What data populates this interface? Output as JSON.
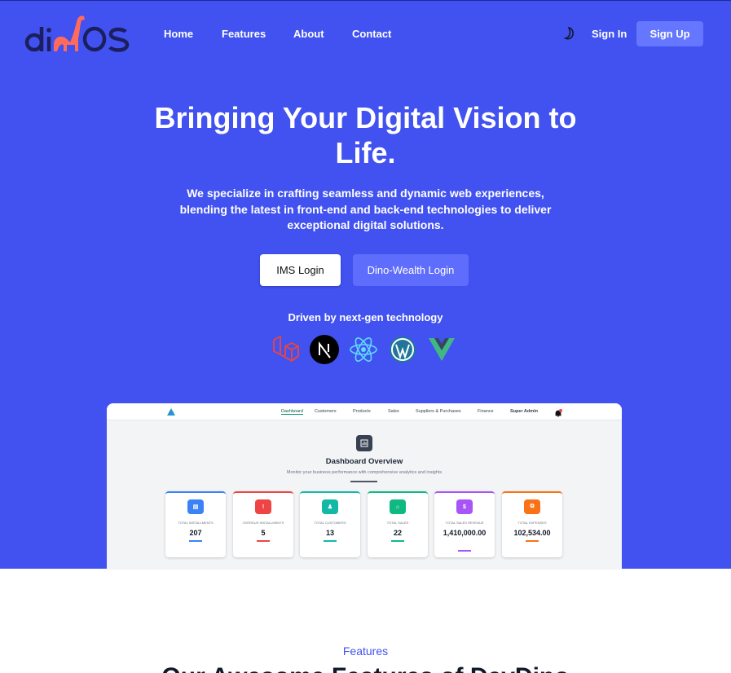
{
  "header": {
    "nav": [
      "Home",
      "Features",
      "About",
      "Contact"
    ],
    "sign_in": "Sign In",
    "sign_up": "Sign Up",
    "theme_icon": "moon-icon"
  },
  "hero": {
    "title": "Bringing Your Digital Vision to Life.",
    "subtitle": "We specialize in crafting seamless and dynamic web experiences, blending the latest in front-end and back-end technologies to deliver exceptional digital solutions.",
    "primary_button": "IMS Login",
    "secondary_button": "Dino-Wealth Login",
    "tech_label": "Driven by next-gen technology",
    "tech_icons": [
      "laravel-icon",
      "nextjs-icon",
      "react-icon",
      "wordpress-icon",
      "vue-icon"
    ]
  },
  "dashboard_preview": {
    "nav": [
      "Dashboard",
      "Customers",
      "Products",
      "Sales",
      "Suppliers & Purchases",
      "Finance",
      "Super Admin"
    ],
    "title": "Dashboard Overview",
    "subtitle": "Monitor your business performance with comprehensive analytics and insights",
    "cards": [
      {
        "label": "TOTAL INSTALLMENTS",
        "value": "207",
        "color": "#3b82f6"
      },
      {
        "label": "OVERDUE INSTALLMENTS",
        "value": "5",
        "color": "#ef4444"
      },
      {
        "label": "TOTAL CUSTOMERS",
        "value": "13",
        "color": "#14b8a6"
      },
      {
        "label": "TOTAL SALES",
        "value": "22",
        "color": "#10b981"
      },
      {
        "label": "TOTAL SALES REVENUE",
        "value": "1,410,000.00",
        "color": "#a855f7"
      },
      {
        "label": "TOTAL EXPENSES",
        "value": "102,534.00",
        "color": "#f97316"
      }
    ]
  },
  "features": {
    "label": "Features",
    "heading": "Our Awesome Features of DevDino"
  },
  "colors": {
    "hero_bg": "#4152f0",
    "accent": "#6577ff",
    "logo_dark": "#1b1f5e",
    "logo_orange": "#ff6b5b"
  }
}
